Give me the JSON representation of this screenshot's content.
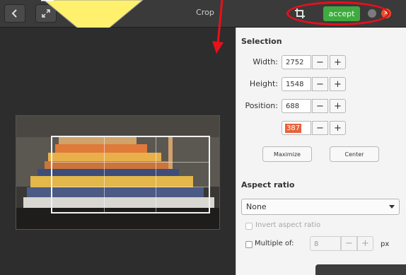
{
  "titlebar": {
    "back_icon": "chevron-left-icon",
    "fullscreen_icon": "expand-icon",
    "title": "Crop",
    "crop_icon": "crop-icon",
    "accept_label": "accept",
    "minimize_icon": "minimize-icon",
    "close_icon": "close-icon"
  },
  "selection": {
    "header": "Selection",
    "width_label": "Width:",
    "width_value": "2752",
    "height_label": "Height:",
    "height_value": "1548",
    "position_label": "Position:",
    "position_x": "688",
    "position_y": "387",
    "minus": "−",
    "plus": "+",
    "maximize_label": "Maximize",
    "center_label": "Center"
  },
  "aspect": {
    "header": "Aspect ratio",
    "selected": "None",
    "invert_label": "Invert aspect ratio",
    "multiple_label": "Multiple of:",
    "multiple_value": "8",
    "multiple_unit": "px"
  },
  "colors": {
    "accept_green": "#3faa3f",
    "annotation_red": "#e8101c",
    "annotation_yellow": "#fff06e",
    "close_orange": "#e2512b"
  }
}
